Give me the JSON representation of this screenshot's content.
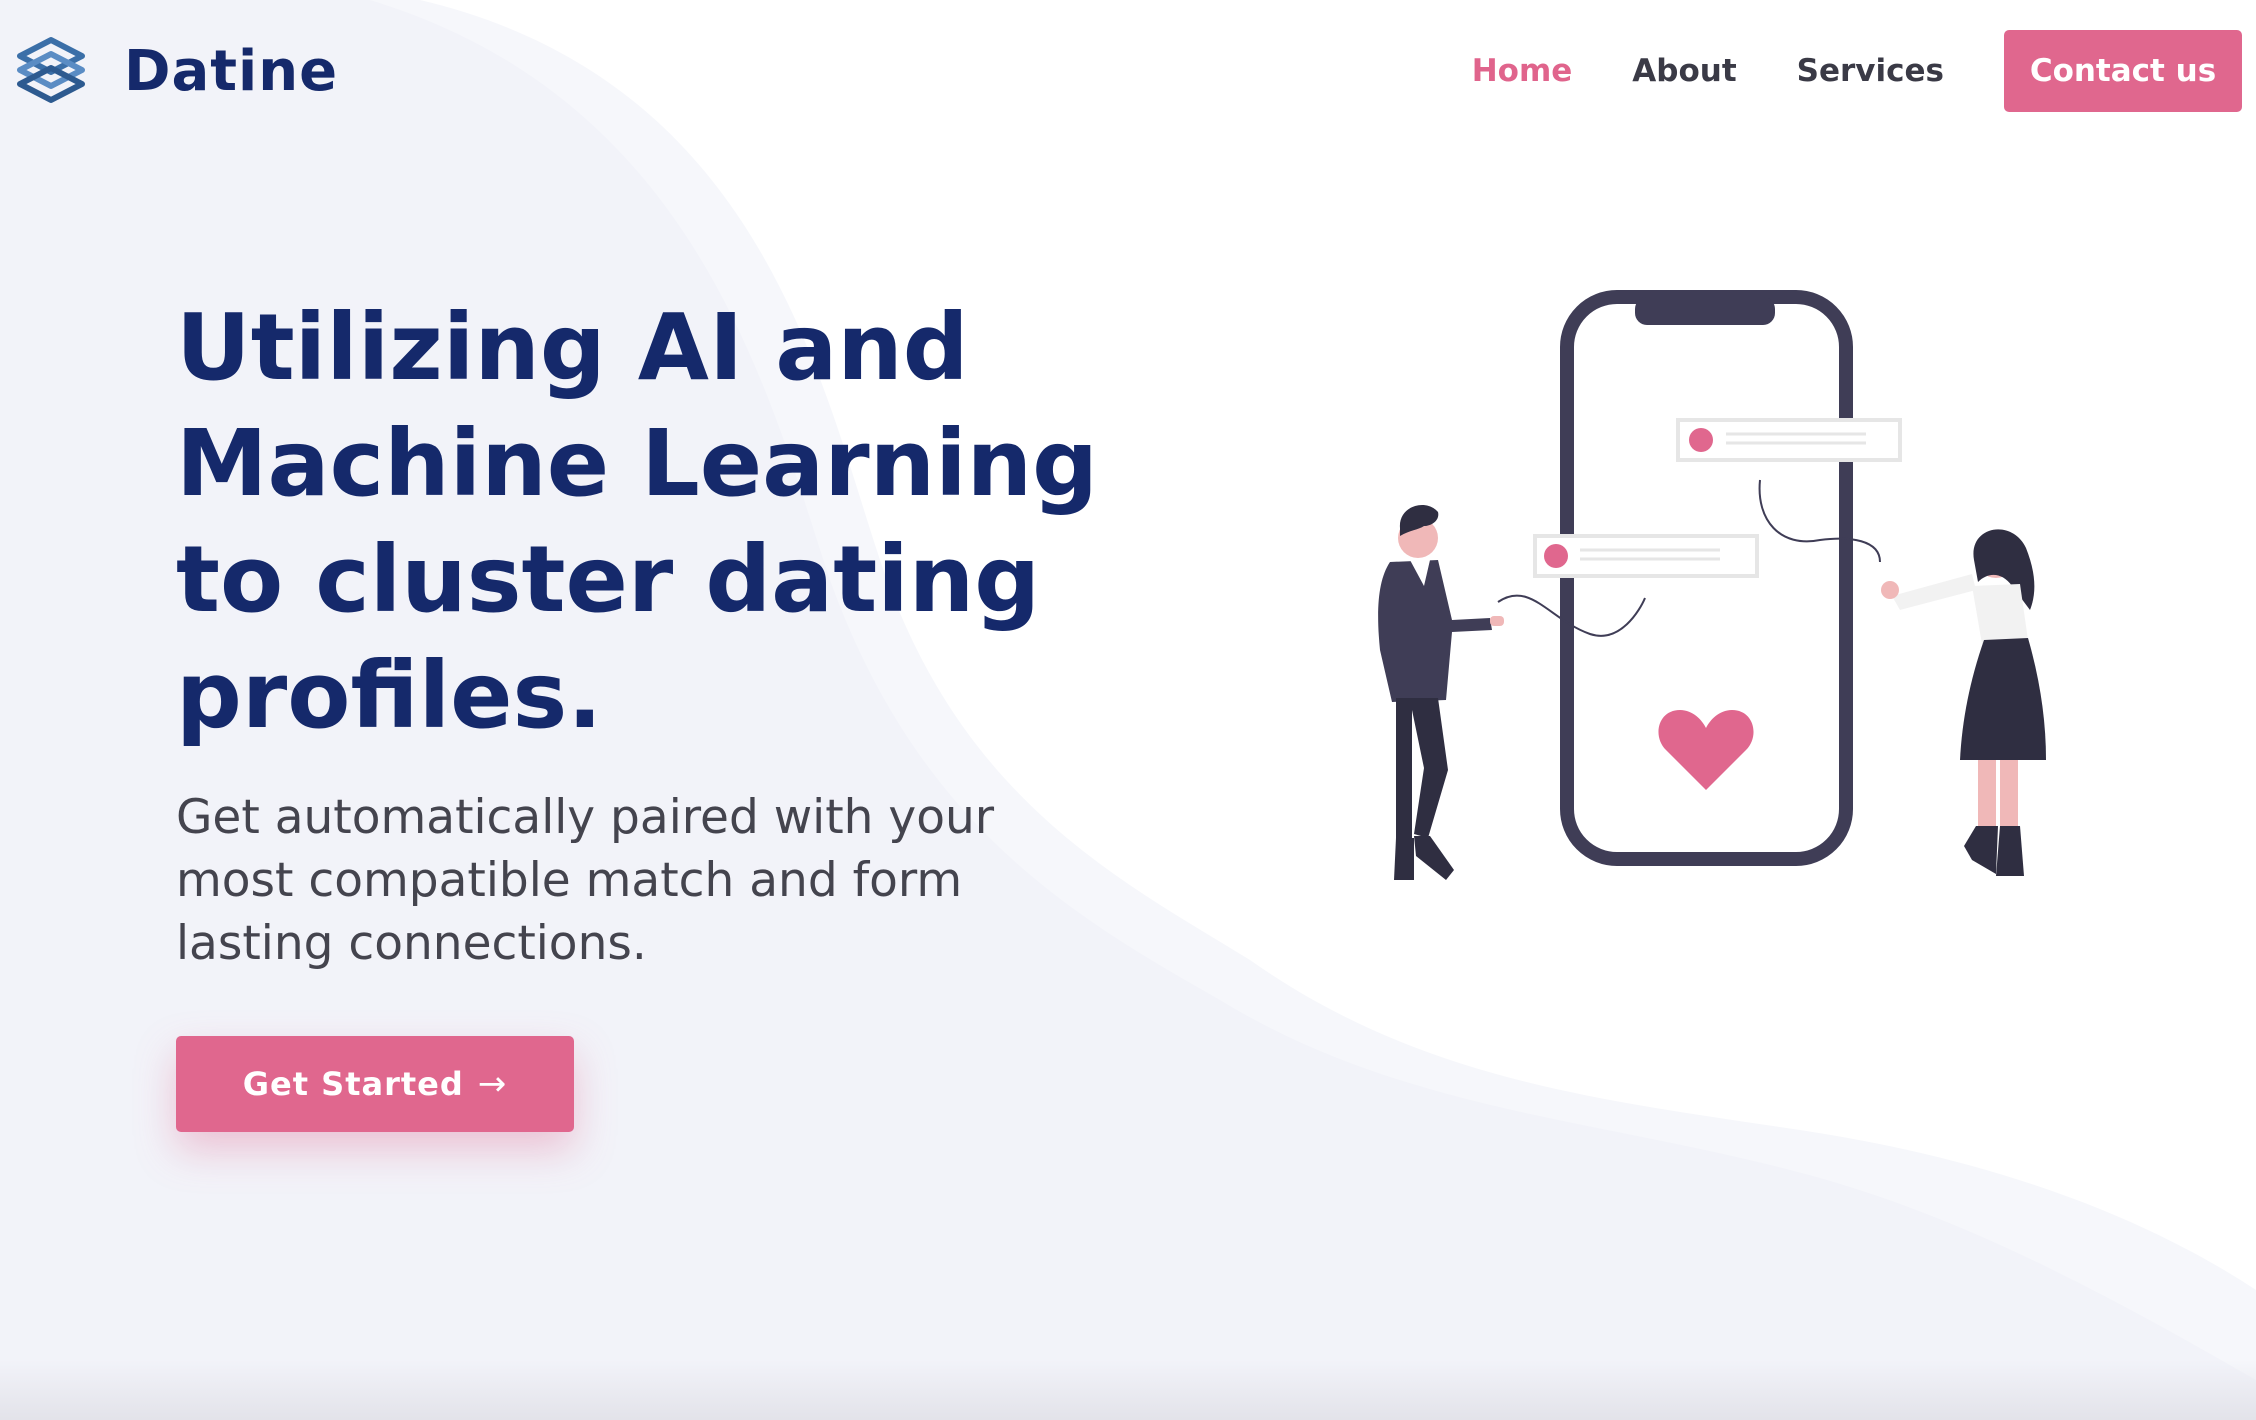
{
  "brand": {
    "name": "Datine",
    "logo_icon": "layered-cube-icon"
  },
  "nav": {
    "items": [
      {
        "label": "Home",
        "active": true
      },
      {
        "label": "About",
        "active": false
      },
      {
        "label": "Services",
        "active": false
      }
    ],
    "contact_label": "Contact us"
  },
  "hero": {
    "title": "Utilizing AI and Machine Learning to cluster dating profiles.",
    "subtitle": "Get automatically paired with your most compatible match and form lasting connections.",
    "cta_label": "Get Started",
    "cta_icon": "arrow-right-icon",
    "illustration": "couple-phone-illustration"
  },
  "colors": {
    "brand_navy": "#15296b",
    "accent_pink": "#e0678e",
    "text_dark": "#3a3a46",
    "wave_bg": "#f3f4f9"
  }
}
